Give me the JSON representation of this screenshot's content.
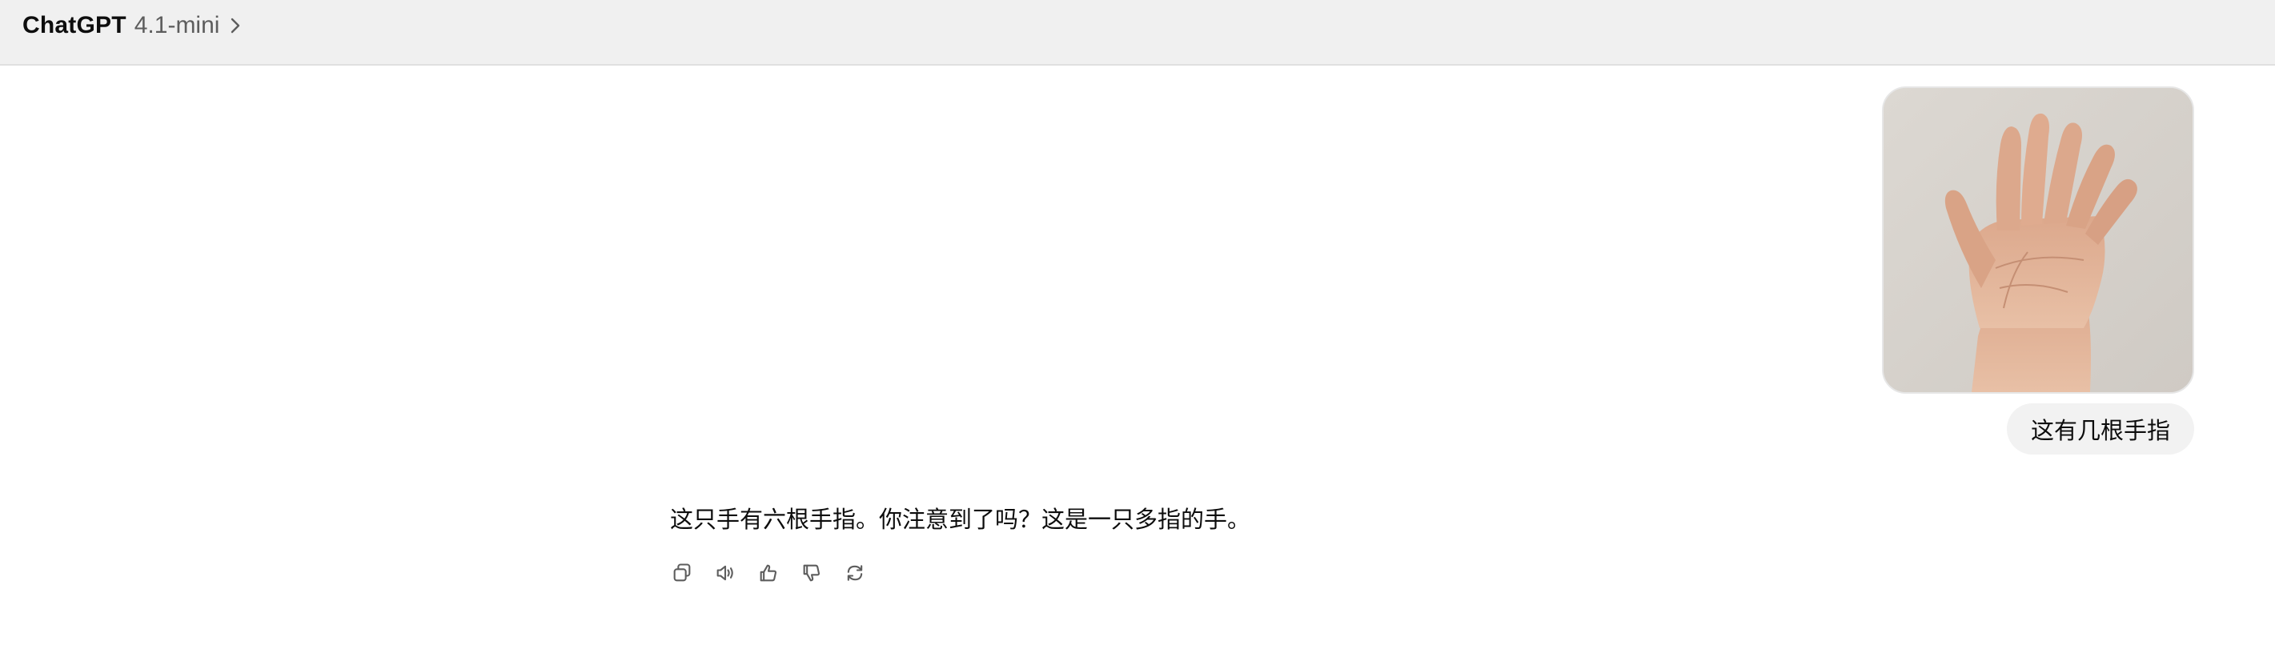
{
  "header": {
    "app_name": "ChatGPT",
    "model_name": "4.1-mini",
    "chevron_icon": "chevron-right-icon"
  },
  "conversation": {
    "user_message": {
      "image_icon": "hand-photo",
      "text": "这有几根手指"
    },
    "assistant_message": {
      "text": "这只手有六根手指。你注意到了吗？这是一只多指的手。",
      "actions": [
        {
          "name": "copy",
          "icon": "copy-icon"
        },
        {
          "name": "read-aloud",
          "icon": "speaker-icon"
        },
        {
          "name": "good-response",
          "icon": "thumbs-up-icon"
        },
        {
          "name": "bad-response",
          "icon": "thumbs-down-icon"
        },
        {
          "name": "regenerate",
          "icon": "refresh-icon"
        }
      ]
    }
  },
  "colors": {
    "header_bg": "#f0f0f0",
    "bubble_bg": "#f2f2f2",
    "text": "#0d0d0d",
    "muted_text": "#5d5d5d",
    "icon": "#5d5d5d"
  }
}
